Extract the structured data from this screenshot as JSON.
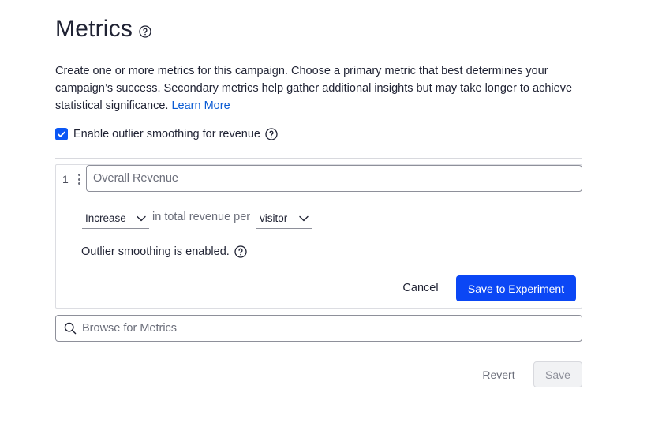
{
  "header": {
    "title": "Metrics",
    "help_icon": "question-circle-icon"
  },
  "description": {
    "text": "Create one or more metrics for this campaign. Choose a primary metric that best determines your campaign’s success. Secondary metrics help gather additional insights but may take longer to achieve statistical significance. ",
    "link_label": "Learn More"
  },
  "outlier": {
    "checked": true,
    "label": "Enable outlier smoothing for revenue",
    "help_icon": "question-circle-icon"
  },
  "metric": {
    "index": "1",
    "name_placeholder": "Overall Revenue",
    "direction": "Increase",
    "connector": "in total revenue per",
    "unit": "visitor",
    "smoothing_status": "Outlier smoothing is enabled.",
    "cancel_label": "Cancel",
    "save_label": "Save to Experiment"
  },
  "browse": {
    "placeholder": "Browse for Metrics",
    "icon": "search-icon"
  },
  "footer": {
    "revert_label": "Revert",
    "save_label": "Save"
  },
  "colors": {
    "primary": "#0b47f5",
    "link": "#0a5bd3",
    "text": "#1f2233",
    "muted": "#6b6e7a"
  }
}
